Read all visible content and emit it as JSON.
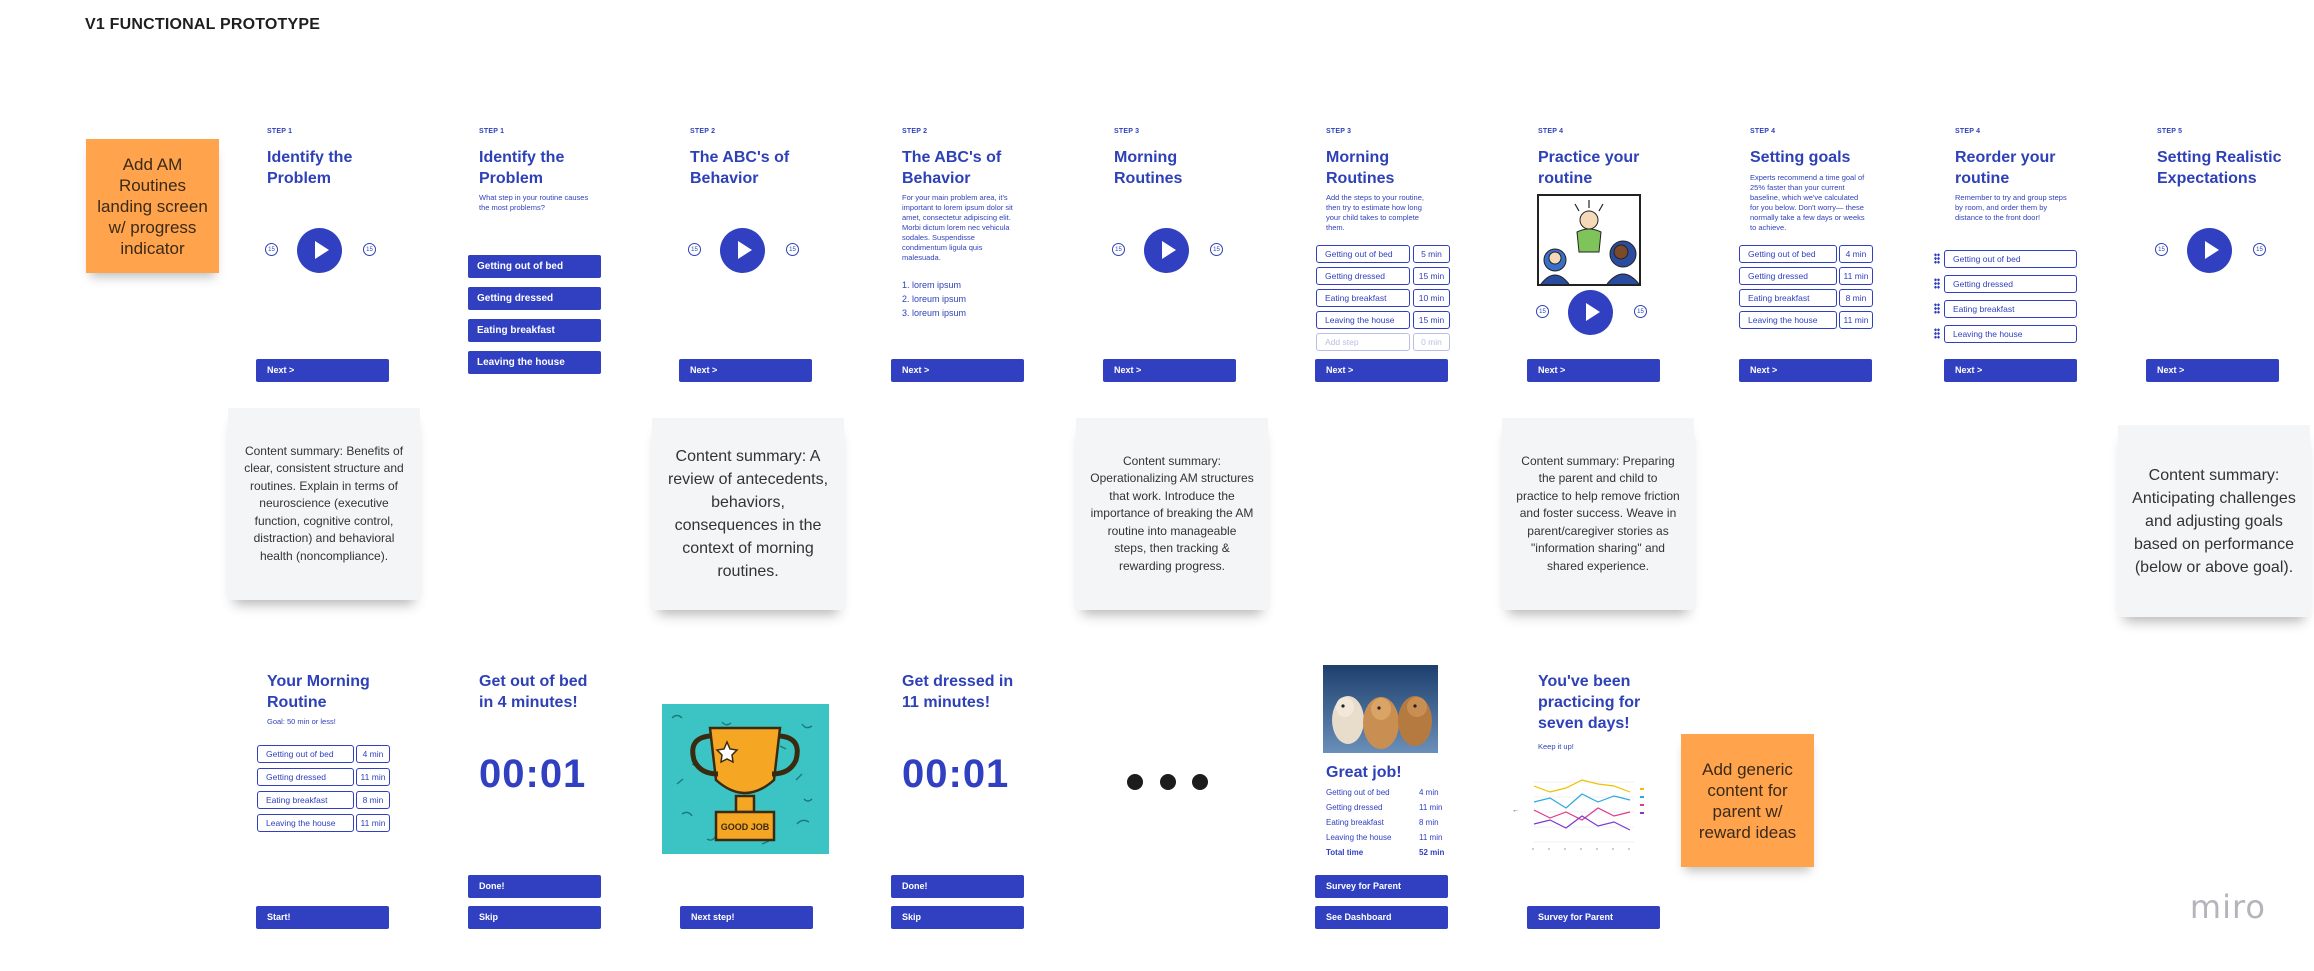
{
  "board_title": "V1 FUNCTIONAL PROTOTYPE",
  "sticky_notes": {
    "landing": "Add AM Routines landing screen w/ progress indicator",
    "reward": "Add generic content for parent w/ reward ideas",
    "summary1": "Content summary: Benefits of clear, consistent structure and routines. Explain in terms of neuroscience (executive function, cognitive control, distraction) and behavioral health (noncompliance).",
    "summary2": "Content summary: A review of antecedents, behaviors, consequences in the context of morning routines.",
    "summary3": "Content summary: Operationalizing AM structures that work. Introduce the importance of breaking the AM routine into manageable steps, then tracking & rewarding progress.",
    "summary4": "Content summary: Preparing the parent and child  to practice to help remove friction and foster success. Weave in parent/caregiver stories as \"information sharing\" and shared experience.",
    "summary5": "Content summary: Anticipating challenges and adjusting goals based on performance (below or above goal)."
  },
  "player": {
    "back": "15",
    "fwd": "15"
  },
  "next_label": "Next >",
  "screens": {
    "s1": {
      "step": "STEP 1",
      "title": "Identify the Problem"
    },
    "s2": {
      "step": "STEP 1",
      "title": "Identify the Problem",
      "desc": "What step in your routine causes the most problems?",
      "options": [
        "Getting out of bed",
        "Getting dressed",
        "Eating breakfast",
        "Leaving the house"
      ]
    },
    "s3": {
      "step": "STEP 2",
      "title": "The ABC's of Behavior"
    },
    "s4": {
      "step": "STEP 2",
      "title": "The ABC's of Behavior",
      "desc": "For your main problem area, it's important to lorem ipsum dolor sit amet, consectetur adipiscing elit. Morbi dictum lorem nec vehicula sodales. Suspendisse condimentum ligula quis malesuada.",
      "list": [
        "1. lorem ipsum",
        "2. loreum ipsum",
        "3. loreum ipsum"
      ]
    },
    "s5": {
      "step": "STEP 3",
      "title": "Morning Routines"
    },
    "s6": {
      "step": "STEP 3",
      "title": "Morning Routines",
      "desc": "Add the steps to your routine, then try to estimate how long your child takes to complete them.",
      "rows": [
        [
          "Getting out of bed",
          "5 min"
        ],
        [
          "Getting dressed",
          "15 min"
        ],
        [
          "Eating breakfast",
          "10 min"
        ],
        [
          "Leaving the house",
          "15 min"
        ]
      ],
      "add_placeholder": "Add step",
      "min_placeholder": "0 min"
    },
    "s7": {
      "step": "STEP 4",
      "title": "Practice your routine"
    },
    "s8": {
      "step": "STEP 4",
      "title": "Setting goals",
      "desc": "Experts recommend a time goal of 25% faster than your current baseline, which we've calculated for you below. Don't worry— these normally take a few days or weeks to achieve.",
      "rows": [
        [
          "Getting out of bed",
          "4 min"
        ],
        [
          "Getting dressed",
          "11 min"
        ],
        [
          "Eating breakfast",
          "8 min"
        ],
        [
          "Leaving the house",
          "11 min"
        ]
      ]
    },
    "s9": {
      "step": "STEP 4",
      "title": "Reorder your routine",
      "desc": "Remember to try and group steps by room, and order them by distance to the front door!",
      "rows": [
        "Getting out of bed",
        "Getting dressed",
        "Eating breakfast",
        "Leaving the house"
      ]
    },
    "s10": {
      "step": "STEP 5",
      "title": "Setting Realistic Expectations"
    }
  },
  "bottom": {
    "b1": {
      "title": "Your Morning Routine",
      "goal": "Goal: 50 min or less!",
      "rows": [
        [
          "Getting out of bed",
          "4 min"
        ],
        [
          "Getting dressed",
          "11 min"
        ],
        [
          "Eating breakfast",
          "8 min"
        ],
        [
          "Leaving the house",
          "11 min"
        ]
      ],
      "button": "Start!"
    },
    "b2": {
      "title": "Get out of bed in 4 minutes!",
      "timer": "00:01",
      "done": "Done!",
      "skip": "Skip"
    },
    "b3": {
      "trophy_text": "GOOD JOB",
      "button": "Next step!"
    },
    "b4": {
      "title": "Get dressed in 11 minutes!",
      "timer": "00:01",
      "done": "Done!",
      "skip": "Skip"
    },
    "b6": {
      "title": "Great job!",
      "rows": [
        [
          "Getting out of bed",
          "4 min"
        ],
        [
          "Getting dressed",
          "11 min"
        ],
        [
          "Eating breakfast",
          "8 min"
        ],
        [
          "Leaving the house",
          "11 min"
        ]
      ],
      "total": [
        "Total time",
        "52 min"
      ],
      "survey": "Survey for Parent",
      "dashboard": "See Dashboard"
    },
    "b7": {
      "title": "You've been practicing for seven days!",
      "sub": "Keep it up!",
      "survey": "Survey for Parent"
    }
  },
  "brand": "miro",
  "colors": {
    "primary": "#3040c0",
    "sticky_orange": "#ffa44d",
    "sticky_grey": "#f4f5f6"
  }
}
